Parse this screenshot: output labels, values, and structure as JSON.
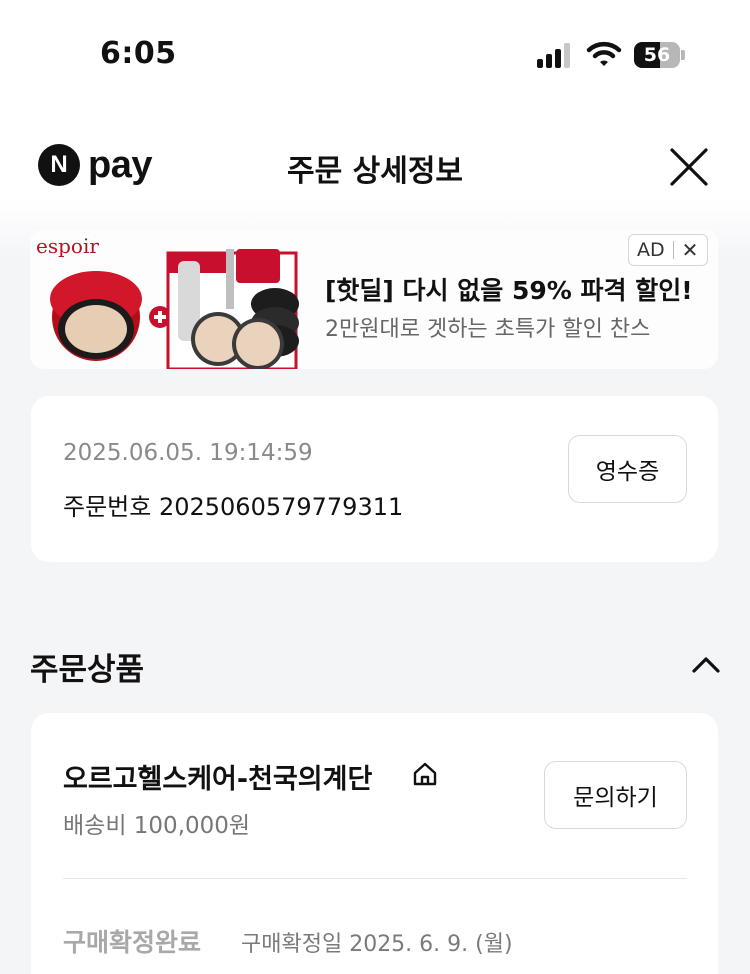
{
  "status_bar": {
    "time": "6:05",
    "battery": "56",
    "icons": [
      "cellular-signal-icon",
      "wifi-icon",
      "battery-icon"
    ]
  },
  "header": {
    "logo_letter": "N",
    "logo_text": "pay",
    "title": "주문 상세정보",
    "close_icon": "close-icon"
  },
  "ad": {
    "brand": "espoir",
    "title": "[핫딜] 다시 없을 59% 파격 할인!",
    "subtitle": "2만원대로 겟하는 초특가 할인 찬스",
    "badge_label": "AD",
    "badge_close": "✕",
    "colors": {
      "accent": "#c8102e"
    }
  },
  "order": {
    "datetime": "2025.06.05. 19:14:59",
    "number_text": "주문번호 2025060579779311",
    "receipt_button": "영수증"
  },
  "section": {
    "title": "주문상품",
    "toggle_icon": "chevron-up-icon"
  },
  "product": {
    "store_name": "오르고헬스케어-천국의계단",
    "store_icon": "home-icon",
    "shipping_text": "배송비 100,000원",
    "inquiry_button": "문의하기",
    "status": "구매확정완료",
    "status_date": "구매확정일 2025. 6. 9. (월)"
  }
}
